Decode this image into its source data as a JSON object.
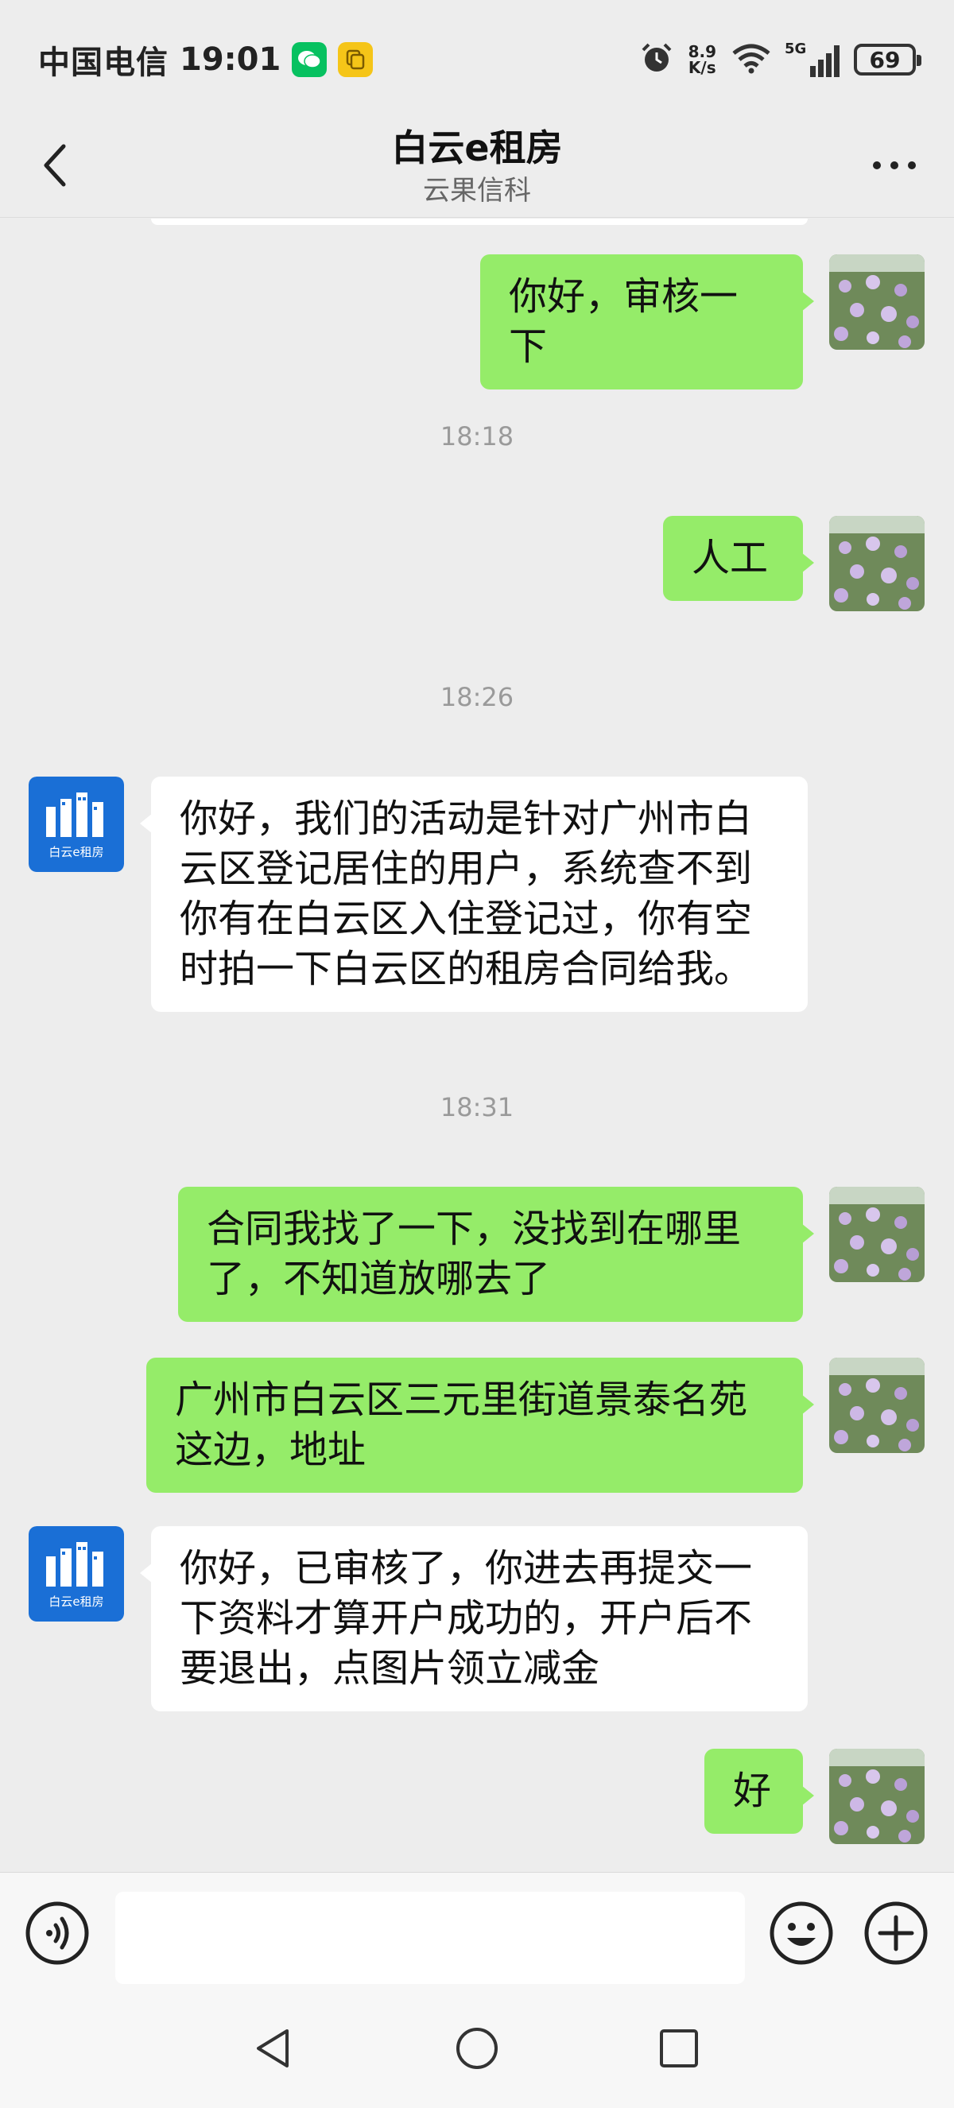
{
  "status_bar": {
    "carrier": "中国电信",
    "time": "19:01",
    "net_speed_value": "8.9",
    "net_speed_unit": "K/s",
    "network": "5G",
    "battery": "69",
    "icons": [
      "wechat-icon",
      "clipboard-icon",
      "alarm-icon",
      "wifi-icon",
      "signal-icon",
      "battery-icon"
    ]
  },
  "header": {
    "title": "白云e租房",
    "subtitle": "云果信科"
  },
  "bot_avatar": {
    "logo_text": "白云e租房"
  },
  "messages": [
    {
      "side": "right",
      "text": "你好，审核一下"
    },
    {
      "type": "time",
      "text": "18:18"
    },
    {
      "side": "right",
      "text": "人工"
    },
    {
      "type": "time",
      "text": "18:26"
    },
    {
      "side": "left",
      "text": "你好，我们的活动是针对广州市白云区登记居住的用户，系统查不到你有在白云区入住登记过，你有空时拍一下白云区的租房合同给我。"
    },
    {
      "type": "time",
      "text": "18:31"
    },
    {
      "side": "right",
      "text": "合同我找了一下，没找到在哪里了，不知道放哪去了"
    },
    {
      "side": "right",
      "text": "广州市白云区三元里街道景泰名苑这边，地址"
    },
    {
      "side": "left",
      "text": "你好，已审核了，你进去再提交一下资料才算开户成功的，开户后不要退出，点图片领立减金"
    },
    {
      "side": "right",
      "text": "好"
    }
  ],
  "colors": {
    "bubble_self": "#95ec69",
    "bubble_other": "#ffffff",
    "background": "#ededed",
    "bot_brand": "#1a6fd6"
  }
}
